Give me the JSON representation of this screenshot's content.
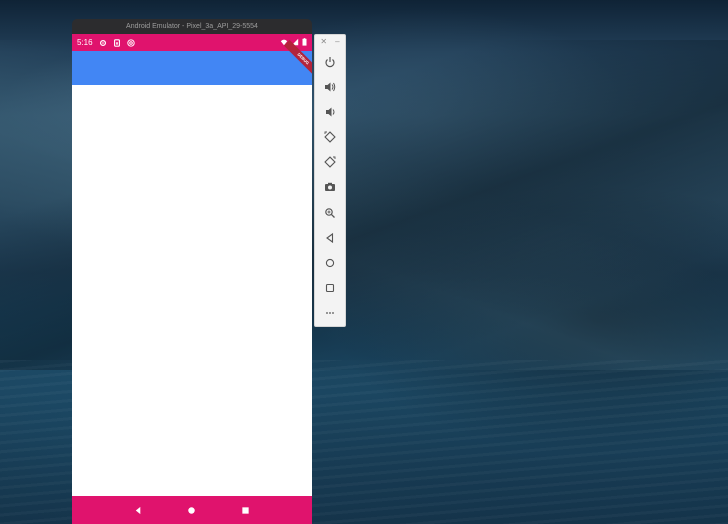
{
  "emulator": {
    "title": "Android Emulator - Pixel_3a_API_29-5554",
    "status_bar": {
      "time": "5:16",
      "color": "#e0136d"
    },
    "app_bar_color": "#4286f4",
    "debug_banner": "DEBUG",
    "nav_bar_color": "#e0136d",
    "nav_buttons": [
      "back-icon",
      "home-icon",
      "recents-icon"
    ]
  },
  "toolbar": {
    "window_controls": [
      "close-icon",
      "minimize-icon"
    ],
    "buttons": [
      "power-icon",
      "volume-up-icon",
      "volume-down-icon",
      "rotate-left-icon",
      "rotate-right-icon",
      "camera-icon",
      "zoom-icon",
      "back-icon",
      "home-icon",
      "overview-icon",
      "more-icon"
    ]
  }
}
